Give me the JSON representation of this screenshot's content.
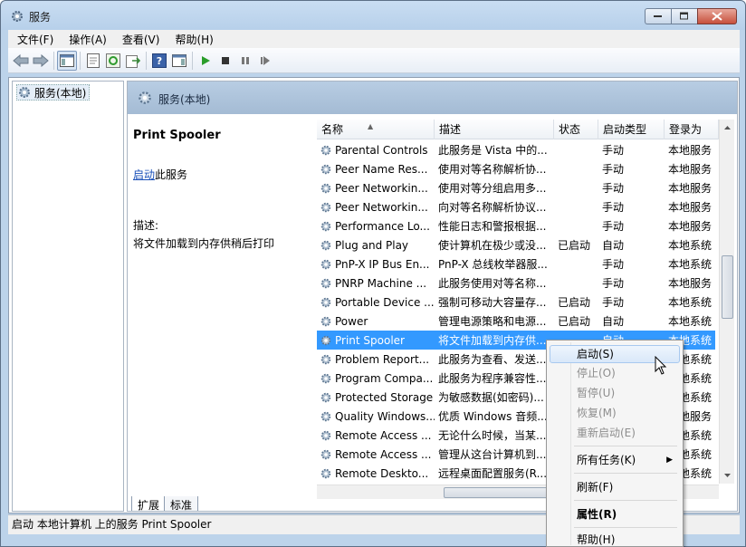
{
  "window": {
    "title": "服务"
  },
  "menu": [
    "文件(F)",
    "操作(A)",
    "查看(V)",
    "帮助(H)"
  ],
  "tree": {
    "root": "服务(本地)"
  },
  "panel": {
    "header": "服务(本地)"
  },
  "description": {
    "service_name": "Print Spooler",
    "start_link": "启动",
    "start_suffix": "此服务",
    "label": "描述:",
    "text": "将文件加载到内存供稍后打印"
  },
  "columns": [
    "名称",
    "描述",
    "状态",
    "启动类型",
    "登录为"
  ],
  "rows": [
    {
      "name": "Parental Controls",
      "desc": "此服务是 Vista 中的...",
      "status": "",
      "startup": "手动",
      "logon": "本地服务"
    },
    {
      "name": "Peer Name Res...",
      "desc": "使用对等名称解析协...",
      "status": "",
      "startup": "手动",
      "logon": "本地服务"
    },
    {
      "name": "Peer Networkin...",
      "desc": "使用对等分组启用多...",
      "status": "",
      "startup": "手动",
      "logon": "本地服务"
    },
    {
      "name": "Peer Networkin...",
      "desc": "向对等名称解析协议...",
      "status": "",
      "startup": "手动",
      "logon": "本地服务"
    },
    {
      "name": "Performance Lo...",
      "desc": "性能日志和警报根据...",
      "status": "",
      "startup": "手动",
      "logon": "本地服务"
    },
    {
      "name": "Plug and Play",
      "desc": "使计算机在极少或没...",
      "status": "已启动",
      "startup": "自动",
      "logon": "本地系统"
    },
    {
      "name": "PnP-X IP Bus En...",
      "desc": "PnP-X 总线枚举器服...",
      "status": "",
      "startup": "手动",
      "logon": "本地系统"
    },
    {
      "name": "PNRP Machine ...",
      "desc": "此服务使用对等名称...",
      "status": "",
      "startup": "手动",
      "logon": "本地服务"
    },
    {
      "name": "Portable Device ...",
      "desc": "强制可移动大容量存...",
      "status": "已启动",
      "startup": "手动",
      "logon": "本地系统"
    },
    {
      "name": "Power",
      "desc": "管理电源策略和电源...",
      "status": "已启动",
      "startup": "自动",
      "logon": "本地系统"
    },
    {
      "name": "Print Spooler",
      "desc": "将文件加载到内存供...",
      "status": "",
      "startup": "自动",
      "logon": "本地系统",
      "selected": true
    },
    {
      "name": "Problem Report...",
      "desc": "此服务为查看、发送...",
      "status": "",
      "startup": "",
      "logon": "本地系统"
    },
    {
      "name": "Program Compa...",
      "desc": "此服务为程序兼容性...",
      "status": "",
      "startup": "",
      "logon": "本地系统"
    },
    {
      "name": "Protected Storage",
      "desc": "为敏感数据(如密码)...",
      "status": "",
      "startup": "",
      "logon": "本地系统"
    },
    {
      "name": "Quality Windows...",
      "desc": "优质 Windows 音频...",
      "status": "",
      "startup": "",
      "logon": "本地服务"
    },
    {
      "name": "Remote Access ...",
      "desc": "无论什么时候，当某...",
      "status": "",
      "startup": "",
      "logon": "本地系统"
    },
    {
      "name": "Remote Access ...",
      "desc": "管理从这台计算机到...",
      "status": "",
      "startup": "",
      "logon": "本地系统"
    },
    {
      "name": "Remote Deskto...",
      "desc": "远程桌面配置服务(R...",
      "status": "",
      "startup": "",
      "logon": "本地系统"
    }
  ],
  "tabs": [
    "扩展",
    "标准"
  ],
  "statusbar": "启动 本地计算机 上的服务 Print Spooler",
  "context_menu": [
    {
      "label": "启动(S)",
      "state": "highlighted"
    },
    {
      "label": "停止(O)",
      "state": "disabled"
    },
    {
      "label": "暂停(U)",
      "state": "disabled"
    },
    {
      "label": "恢复(M)",
      "state": "disabled"
    },
    {
      "label": "重新启动(E)",
      "state": "disabled"
    },
    {
      "label": "所有任务(K)",
      "state": "submenu"
    },
    {
      "label": "刷新(F)",
      "state": "normal"
    },
    {
      "label": "属性(R)",
      "state": "bold"
    },
    {
      "label": "帮助(H)",
      "state": "normal"
    }
  ],
  "colors": {
    "selection": "#3399ff",
    "link": "#1a50b8",
    "panel_header": "#a4bbd4"
  }
}
